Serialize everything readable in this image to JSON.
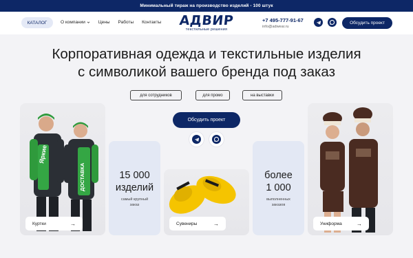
{
  "topbar": {
    "text": "Минимальный тираж на производство изделий - 100 штук"
  },
  "header": {
    "catalog_label": "КАТАЛОГ",
    "nav": [
      {
        "label": "О компании",
        "has_dropdown": true
      },
      {
        "label": "Цены"
      },
      {
        "label": "Работы"
      },
      {
        "label": "Контакты"
      }
    ],
    "logo_word": "АДВИР",
    "logo_sub": "текстильные решения",
    "phone": "+7 495-777-91-67",
    "email": "info@adwear.ru",
    "discuss_label": "Обсудить проект",
    "icons": [
      "telegram-icon",
      "messenger-icon"
    ]
  },
  "hero": {
    "title_line1": "Корпоративная одежда и текстильные изделия",
    "title_line2": "с символикой вашего бренда под заказ",
    "tags": [
      "для сотрудников",
      "для промо",
      "на выставки"
    ],
    "cta_label": "Обсудить проект"
  },
  "cards": {
    "jackets": {
      "label": "Куртки",
      "print_line1": "Яркие",
      "print_line2": "ДОСТАВКА"
    },
    "stat1": {
      "number_line1": "15 000",
      "number_line2": "изделий",
      "caption_line1": "самый крупный",
      "caption_line2": "заказ"
    },
    "souvenirs": {
      "label": "Сувениры"
    },
    "stat2": {
      "number_line1": "более",
      "number_line2": "1 000",
      "caption_line1": "выполненных",
      "caption_line2": "заказов"
    },
    "uniform": {
      "label": "Униформа"
    }
  },
  "colors": {
    "brand": "#0d2766",
    "page_bg": "#f3f3f6",
    "stat_bg": "#e3e8f4",
    "jacket_green": "#2f9a3c",
    "slipper_yellow": "#f5c400",
    "apron_brown": "#4a2b21"
  }
}
